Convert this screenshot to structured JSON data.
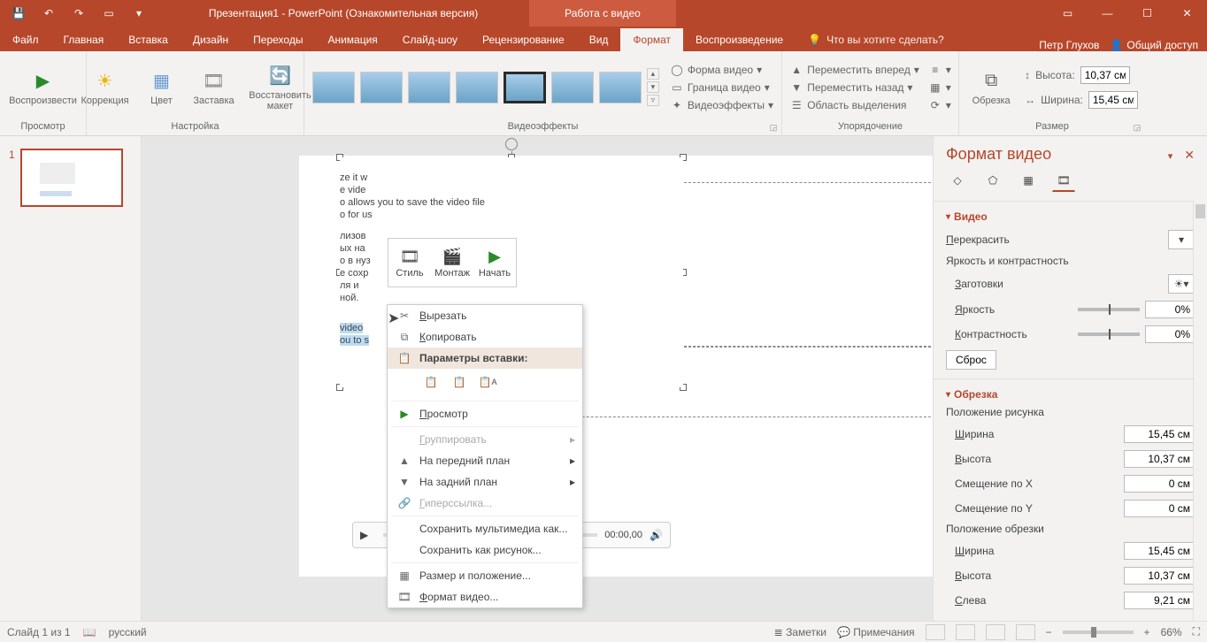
{
  "app": {
    "title_main": "Презентация1 - PowerPoint (Ознакомительная версия)",
    "title_context": "Работа с видео",
    "user": "Петр Глухов",
    "share": "Общий доступ"
  },
  "tabs": {
    "file": "Файл",
    "home": "Главная",
    "insert": "Вставка",
    "design": "Дизайн",
    "transitions": "Переходы",
    "animation": "Анимация",
    "slideshow": "Слайд-шоу",
    "review": "Рецензирование",
    "view": "Вид",
    "format": "Формат",
    "playback": "Воспроизведение",
    "tellme": "Что вы хотите сделать?"
  },
  "ribbon": {
    "preview_group": "Просмотр",
    "play": "Воспроизвести",
    "adjust_group": "Настройка",
    "corrections": "Коррекция",
    "color": "Цвет",
    "poster": "Заставка",
    "reset": "Восстановить макет",
    "styles_group": "Видеоэффекты",
    "shape": "Форма видео",
    "border": "Граница видео",
    "effects": "Видеоэффекты",
    "arrange_group": "Упорядочение",
    "bring_fwd": "Переместить вперед",
    "send_back": "Переместить назад",
    "selection_pane": "Область выделения",
    "size_group": "Размер",
    "crop": "Обрезка",
    "height_lbl": "Высота:",
    "width_lbl": "Ширина:",
    "height_val": "10,37 см",
    "width_val": "15,45 см"
  },
  "mini_toolbar": {
    "style": "Стиль",
    "trim": "Монтаж",
    "start": "Начать"
  },
  "context_menu": {
    "cut": "Вырезать",
    "copy": "Копировать",
    "paste_header": "Параметры вставки:",
    "preview": "Просмотр",
    "group": "Группировать",
    "bring_front": "На передний план",
    "send_back": "На задний план",
    "hyperlink": "Гиперссылка...",
    "save_media": "Сохранить мультимедиа как...",
    "save_picture": "Сохранить как рисунок...",
    "size_position": "Размер и положение...",
    "format_video": "Формат видео..."
  },
  "video_text": {
    "l1": "ze it w",
    "l2": "e vide",
    "l3": "o allows you to save the video file",
    "l4": "o for us",
    "l5": "лизов",
    "l6": "ых на",
    "l7": "о в нуз",
    "l8": "е сохр",
    "l9": "ля и",
    "l10": "ной.",
    "hl1": "video",
    "hl2": "ou to s"
  },
  "player": {
    "time": "00:00,00"
  },
  "format_pane": {
    "title": "Формат видео",
    "video_section": "Видео",
    "recolor": "Перекрасить",
    "brightness_contrast": "Яркость и контрастность",
    "presets": "Заготовки",
    "brightness": "Яркость",
    "contrast": "Контрастность",
    "zero_pct": "0%",
    "reset": "Сброс",
    "crop_section": "Обрезка",
    "picture_position": "Положение рисунка",
    "width": "Ширина",
    "height": "Высота",
    "offset_x": "Смещение по X",
    "offset_y": "Смещение по Y",
    "crop_position": "Положение обрезки",
    "left": "Слева",
    "w_val": "15,45 см",
    "h_val": "10,37 см",
    "zero_cm": "0 см",
    "left_val": "9,21 см"
  },
  "statusbar": {
    "slide_count": "Слайд 1 из 1",
    "lang": "русский",
    "notes": "Заметки",
    "comments": "Примечания",
    "zoom": "66%"
  },
  "thumbs": {
    "slide1": "1"
  }
}
